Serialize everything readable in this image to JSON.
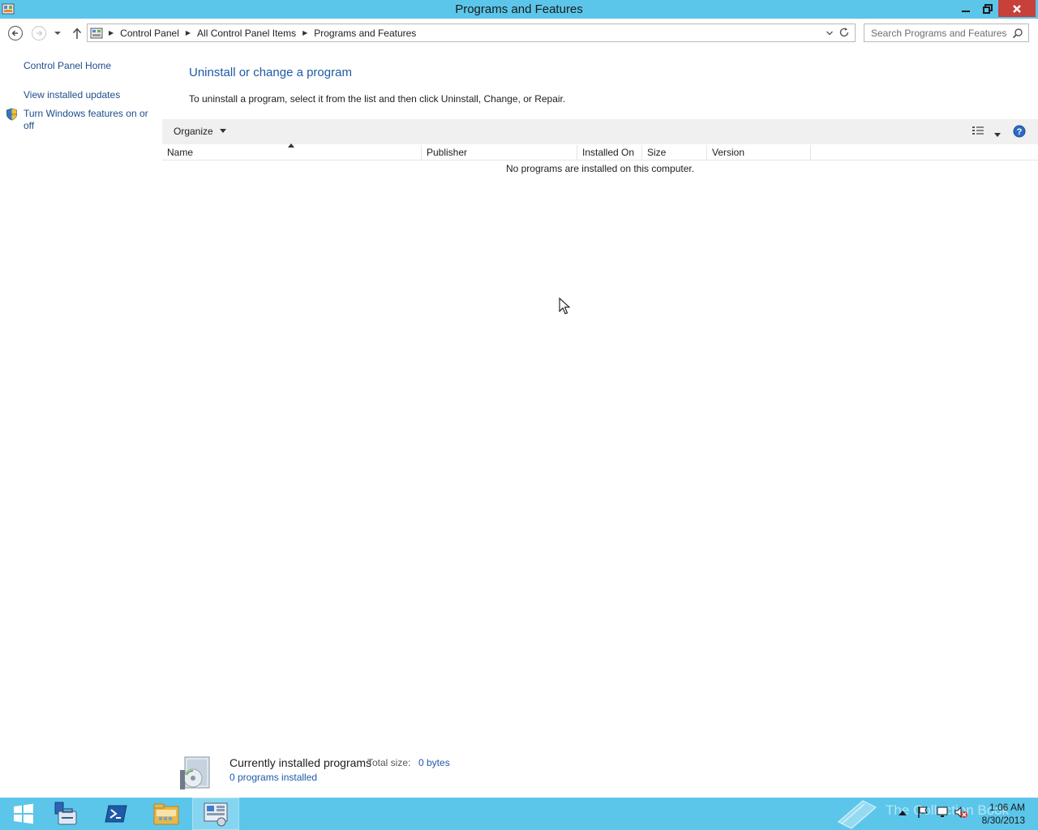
{
  "window": {
    "title": "Programs and Features"
  },
  "navigation": {
    "breadcrumbs": [
      "Control Panel",
      "All Control Panel Items",
      "Programs and Features"
    ],
    "search_placeholder": "Search Programs and Features"
  },
  "left_pane": {
    "home_link": "Control Panel Home",
    "updates_link": "View installed updates",
    "features_link": "Turn Windows features on or off"
  },
  "main": {
    "heading": "Uninstall or change a program",
    "description": "To uninstall a program, select it from the list and then click Uninstall, Change, or Repair.",
    "organize_label": "Organize",
    "columns": [
      "Name",
      "Publisher",
      "Installed On",
      "Size",
      "Version"
    ],
    "empty_message": "No programs are installed on this computer."
  },
  "details": {
    "title": "Currently installed programs",
    "total_size_label": "Total size:",
    "total_size_value": "0 bytes",
    "count_text": "0 programs installed"
  },
  "taskbar": {
    "watermark": "The Collection Book",
    "time": "1:06 AM",
    "date": "8/30/2013"
  },
  "colors": {
    "titlebar": "#5bc6ea",
    "close_button": "#c7403a",
    "link": "#1d4d8c",
    "heading": "#1e5aa8"
  }
}
